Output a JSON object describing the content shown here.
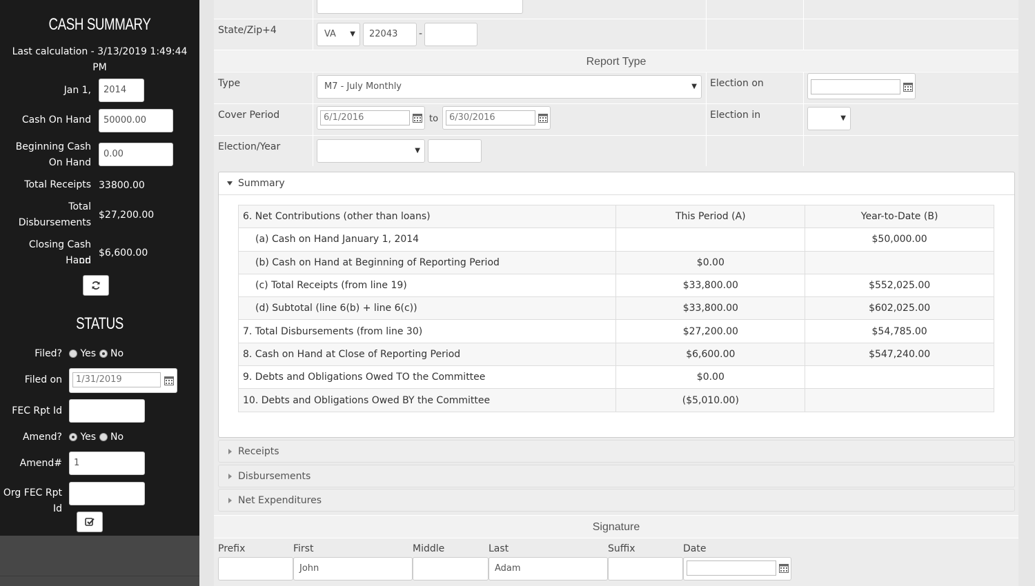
{
  "sidebar": {
    "cash_summary_title": "CASH SUMMARY",
    "last_calc_line1": "Last calculation - 3/13/2019 1:49:44",
    "last_calc_line2": "PM",
    "jan1_label": "Jan 1,",
    "jan1_value": "2014",
    "cash_on_hand_label": "Cash On Hand",
    "cash_on_hand_value": "50000.00",
    "beginning_label_1": "Beginning Cash",
    "beginning_label_2": "On Hand",
    "beginning_value": "0.00",
    "total_receipts_label": "Total Receipts",
    "total_receipts_value": "33800.00",
    "total_disb_label_1": "Total",
    "total_disb_label_2": "Disbursements",
    "total_disb_value": "$27,200.00",
    "closing_label_1": "Closing Cash on",
    "closing_label_2": "Hand",
    "closing_value": "$6,600.00",
    "status_title": "STATUS",
    "filed_label": "Filed?",
    "filed_yes": "Yes",
    "filed_no": "No",
    "filed_on_label": "Filed on",
    "filed_on_value": "1/31/2019",
    "fec_rpt_id_label": "FEC Rpt Id",
    "fec_rpt_id_value": "",
    "amend_label": "Amend?",
    "amend_yes": "Yes",
    "amend_no": "No",
    "amend_num_label": "Amend#",
    "amend_num_value": "1",
    "org_fec_label": "Org FEC Rpt Id",
    "org_fec_value": ""
  },
  "address": {
    "state_zip_label": "State/Zip+4",
    "state": "VA",
    "zip": "22043",
    "zip_dash": "-",
    "zip4": ""
  },
  "report_type": {
    "title": "Report Type",
    "type_label": "Type",
    "type_value": "M7 - July Monthly",
    "election_on_label": "Election on",
    "election_on_value": "",
    "cover_period_label": "Cover Period",
    "cover_from": "6/1/2016",
    "to_label": "to",
    "cover_to": "6/30/2016",
    "election_in_label": "Election in",
    "election_in_value": "",
    "election_year_label": "Election/Year",
    "election_value": "",
    "year_value": ""
  },
  "summary": {
    "title": "Summary",
    "headers": [
      "6. Net Contributions (other than loans)",
      "This Period (A)",
      "Year-to-Date (B)"
    ],
    "rows": [
      {
        "label": "(a) Cash on Hand January 1, 2014",
        "a": "",
        "b": "$50,000.00",
        "indent": true
      },
      {
        "label": "(b) Cash on Hand at Beginning of Reporting Period",
        "a": "$0.00",
        "b": "",
        "indent": true
      },
      {
        "label": "(c) Total Receipts (from line 19)",
        "a": "$33,800.00",
        "b": "$552,025.00",
        "indent": true
      },
      {
        "label": "(d) Subtotal (line 6(b) + line 6(c))",
        "a": "$33,800.00",
        "b": "$602,025.00",
        "indent": true
      },
      {
        "label": "7. Total Disbursements (from line 30)",
        "a": "$27,200.00",
        "b": "$54,785.00",
        "indent": false
      },
      {
        "label": "8. Cash on Hand at Close of Reporting Period",
        "a": "$6,600.00",
        "b": "$547,240.00",
        "indent": false
      },
      {
        "label": "9. Debts and Obligations Owed TO the Committee",
        "a": "$0.00",
        "b": "",
        "indent": false
      },
      {
        "label": "10. Debts and Obligations Owed BY the Committee",
        "a": "($5,010.00)",
        "b": "",
        "indent": false
      }
    ]
  },
  "accordions": {
    "receipts": "Receipts",
    "disbursements": "Disbursements",
    "net_expenditures": "Net Expenditures"
  },
  "signature": {
    "title": "Signature",
    "prefix_label": "Prefix",
    "first_label": "First",
    "middle_label": "Middle",
    "last_label": "Last",
    "suffix_label": "Suffix",
    "date_label": "Date",
    "prefix": "",
    "first": "John",
    "middle": "",
    "last": "Adam",
    "suffix": "",
    "date": ""
  },
  "icons": {
    "refresh": "refresh-icon",
    "check": "check-square-icon",
    "calendar": "calendar-icon"
  }
}
